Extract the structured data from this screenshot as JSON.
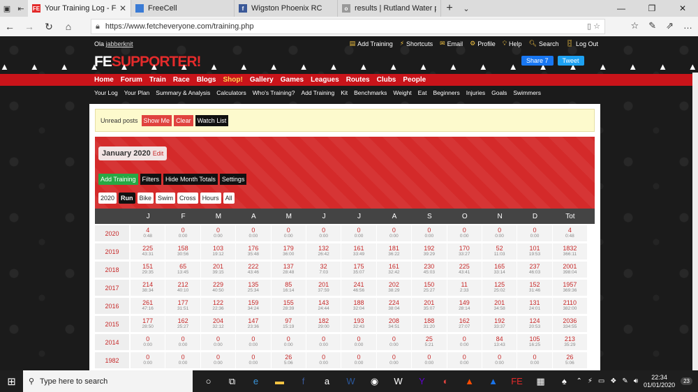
{
  "browser": {
    "tabs": [
      {
        "title": "Your Training Log - Fetc",
        "favicon": "FE",
        "color": "#e32b2b",
        "active": true
      },
      {
        "title": "FreeCell",
        "favicon": "freecell-icon",
        "color": "#3a7bd5",
        "active": false
      },
      {
        "title": "Wigston Phoenix RC",
        "favicon": "f",
        "color": "#3b5998",
        "active": false
      },
      {
        "title": "results | Rutland Water park",
        "favicon": "o",
        "color": "#999999",
        "active": false
      }
    ],
    "url": "https://www.fetcheveryone.com/training.php"
  },
  "site": {
    "greeting": "Ola",
    "username": "jabberknit",
    "toplinks": [
      "Add Training",
      "Shortcuts",
      "Email",
      "Profile",
      "Help",
      "Search",
      "Log Out"
    ],
    "logo_fe": "FE",
    "logo_rest": "SUPPORTER!",
    "share_fb": "Share 7",
    "share_tw": "Tweet",
    "mainnav": [
      "Home",
      "Forum",
      "Train",
      "Race",
      "Blogs",
      "Shop!",
      "Gallery",
      "Games",
      "Leagues",
      "Routes",
      "Clubs",
      "People"
    ],
    "subnav": [
      "Your Log",
      "Your Plan",
      "Summary & Analysis",
      "Calculators",
      "Who's Training?",
      "Add Training",
      "Kit",
      "Benchmarks",
      "Weight",
      "Eat",
      "Beginners",
      "Injuries",
      "Goals",
      "Swimmers"
    ]
  },
  "unread": {
    "label": "Unread posts",
    "show_me": "Show Me",
    "clear": "Clear",
    "watch_list": "Watch List"
  },
  "calendar": {
    "month": "January 2020",
    "edit": "Edit",
    "actions": [
      "Add Training",
      "Filters",
      "Hide Month Totals",
      "Settings"
    ],
    "filters": [
      "2020",
      "Run",
      "Bike",
      "Swim",
      "Cross",
      "Hours",
      "All"
    ],
    "selected_filter": "Run",
    "headers": [
      "",
      "J",
      "F",
      "M",
      "A",
      "M",
      "J",
      "J",
      "A",
      "S",
      "O",
      "N",
      "D",
      "Tot"
    ],
    "rows": [
      {
        "year": "2020",
        "cells": [
          [
            "4",
            "0:48"
          ],
          [
            "0",
            "0:00"
          ],
          [
            "0",
            "0:00"
          ],
          [
            "0",
            "0:00"
          ],
          [
            "0",
            "0:00"
          ],
          [
            "0",
            "0:00"
          ],
          [
            "0",
            "0:00"
          ],
          [
            "0",
            "0:00"
          ],
          [
            "0",
            "0:00"
          ],
          [
            "0",
            "0:00"
          ],
          [
            "0",
            "0:00"
          ],
          [
            "0",
            "0:00"
          ],
          [
            "4",
            "0:48"
          ]
        ]
      },
      {
        "year": "2019",
        "cells": [
          [
            "225",
            "43:31"
          ],
          [
            "158",
            "30:56"
          ],
          [
            "103",
            "19:12"
          ],
          [
            "176",
            "35:48"
          ],
          [
            "179",
            "36:00"
          ],
          [
            "132",
            "26:42"
          ],
          [
            "161",
            "33:49"
          ],
          [
            "181",
            "36:22"
          ],
          [
            "192",
            "39:29"
          ],
          [
            "170",
            "33:27"
          ],
          [
            "52",
            "11:03"
          ],
          [
            "101",
            "19:53"
          ],
          [
            "1832",
            "366:11"
          ]
        ]
      },
      {
        "year": "2018",
        "cells": [
          [
            "151",
            "29:35"
          ],
          [
            "65",
            "13:45"
          ],
          [
            "201",
            "39:15"
          ],
          [
            "222",
            "43:46"
          ],
          [
            "137",
            "28:48"
          ],
          [
            "32",
            "7:03"
          ],
          [
            "175",
            "35:07"
          ],
          [
            "161",
            "32:42"
          ],
          [
            "230",
            "45:03"
          ],
          [
            "225",
            "43:41"
          ],
          [
            "165",
            "33:14"
          ],
          [
            "237",
            "46:03"
          ],
          [
            "2001",
            "398:04"
          ]
        ]
      },
      {
        "year": "2017",
        "cells": [
          [
            "214",
            "38:34"
          ],
          [
            "212",
            "40:10"
          ],
          [
            "229",
            "40:50"
          ],
          [
            "135",
            "25:34"
          ],
          [
            "85",
            "16:14"
          ],
          [
            "201",
            "37:59"
          ],
          [
            "241",
            "46:56"
          ],
          [
            "202",
            "38:29"
          ],
          [
            "150",
            "25:27"
          ],
          [
            "11",
            "2:33"
          ],
          [
            "125",
            "25:02"
          ],
          [
            "152",
            "31:46"
          ],
          [
            "1957",
            "369:36"
          ]
        ]
      },
      {
        "year": "2016",
        "cells": [
          [
            "261",
            "47:16"
          ],
          [
            "177",
            "31:51"
          ],
          [
            "122",
            "22:36"
          ],
          [
            "159",
            "34:24"
          ],
          [
            "155",
            "28:39"
          ],
          [
            "143",
            "24:44"
          ],
          [
            "188",
            "32:04"
          ],
          [
            "224",
            "38:04"
          ],
          [
            "201",
            "35:07"
          ],
          [
            "149",
            "28:14"
          ],
          [
            "201",
            "34:58"
          ],
          [
            "131",
            "24:01"
          ],
          [
            "2110",
            "382:00"
          ]
        ]
      },
      {
        "year": "2015",
        "cells": [
          [
            "177",
            "28:50"
          ],
          [
            "162",
            "25:27"
          ],
          [
            "204",
            "32:12"
          ],
          [
            "147",
            "23:36"
          ],
          [
            "97",
            "15:19"
          ],
          [
            "182",
            "29:00"
          ],
          [
            "193",
            "32:43"
          ],
          [
            "208",
            "34:51"
          ],
          [
            "188",
            "31:20"
          ],
          [
            "162",
            "27:07"
          ],
          [
            "192",
            "33:37"
          ],
          [
            "124",
            "20:53"
          ],
          [
            "2036",
            "334:55"
          ]
        ]
      },
      {
        "year": "2014",
        "cells": [
          [
            "0",
            "0:00"
          ],
          [
            "0",
            "0:00"
          ],
          [
            "0",
            "0:00"
          ],
          [
            "0",
            "0:00"
          ],
          [
            "0",
            "0:00"
          ],
          [
            "0",
            "0:00"
          ],
          [
            "0",
            "0:00"
          ],
          [
            "0",
            "0:00"
          ],
          [
            "25",
            "5:21"
          ],
          [
            "0",
            "0:00"
          ],
          [
            "84",
            "13:43"
          ],
          [
            "105",
            "16:25"
          ],
          [
            "213",
            "35:29"
          ]
        ]
      },
      {
        "year": "1982",
        "cells": [
          [
            "0",
            "0:00"
          ],
          [
            "0",
            "0:00"
          ],
          [
            "0",
            "0:00"
          ],
          [
            "0",
            "0:00"
          ],
          [
            "26",
            "5:06"
          ],
          [
            "0",
            "0:00"
          ],
          [
            "0",
            "0:00"
          ],
          [
            "0",
            "0:00"
          ],
          [
            "0",
            "0:00"
          ],
          [
            "0",
            "0:00"
          ],
          [
            "0",
            "0:00"
          ],
          [
            "0",
            "0:00"
          ],
          [
            "26",
            "5:06"
          ]
        ]
      }
    ]
  },
  "taskbar": {
    "search_placeholder": "Type here to search",
    "time": "22:34",
    "date": "01/01/2020",
    "notif_count": "23"
  }
}
